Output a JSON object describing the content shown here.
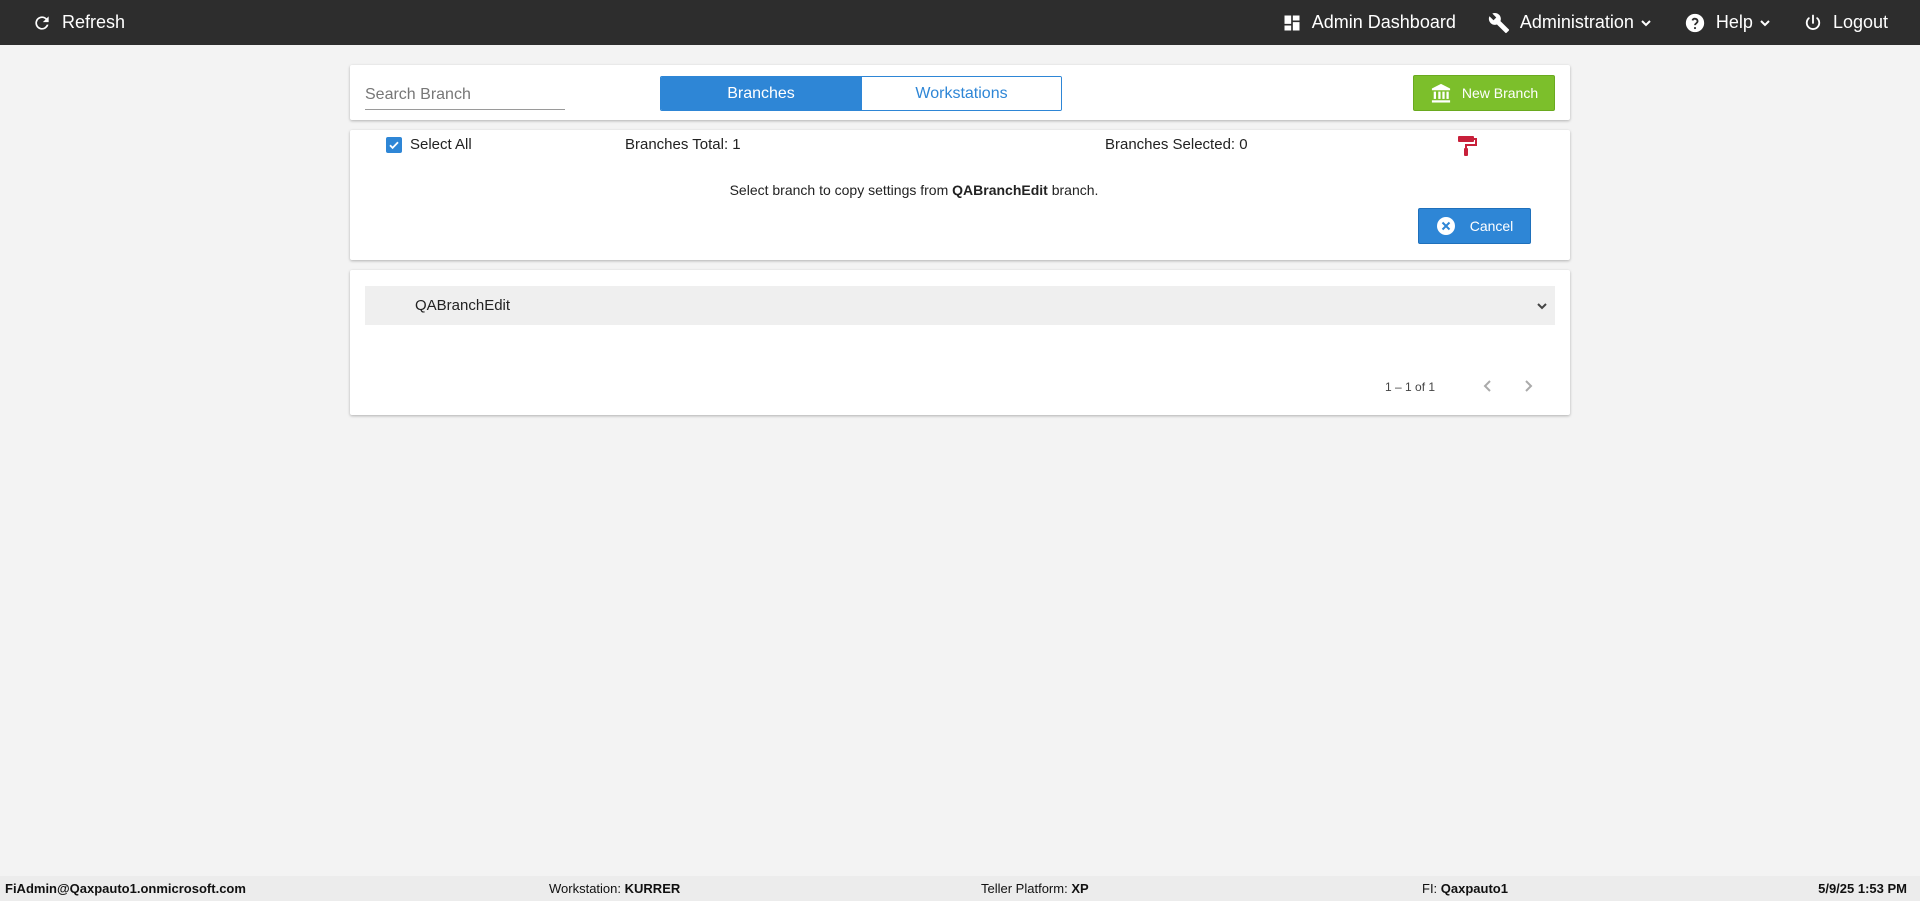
{
  "topbar": {
    "refresh_label": "Refresh",
    "admin_dashboard_label": "Admin Dashboard",
    "administration_label": "Administration",
    "help_label": "Help",
    "logout_label": "Logout"
  },
  "toolbar": {
    "search_placeholder": "Search Branch",
    "tabs": [
      {
        "label": "Branches",
        "active": true
      },
      {
        "label": "Workstations",
        "active": false
      }
    ],
    "new_branch_label": "New Branch"
  },
  "selection": {
    "select_all_label": "Select All",
    "select_all_checked": true,
    "branches_total_label": "Branches Total: 1",
    "branches_selected_label": "Branches Selected: 0",
    "hint_prefix": "Select branch to copy settings from",
    "hint_branch": "QABranchEdit",
    "hint_suffix": "branch.",
    "cancel_label": "Cancel"
  },
  "list": {
    "items": [
      {
        "label": "QABranchEdit"
      }
    ],
    "pager_text": "1 – 1 of 1"
  },
  "footer": {
    "user": "FiAdmin@Qaxpauto1.onmicrosoft.com",
    "workstation_label": "Workstation:",
    "workstation_value": "KURRER",
    "platform_label": "Teller Platform:",
    "platform_value": "XP",
    "fi_label": "FI:",
    "fi_value": "Qaxpauto1",
    "datetime": "5/9/25 1:53 PM"
  },
  "colors": {
    "topbar": "#2d2d2d",
    "accent_blue": "#2e86d6",
    "accent_green": "#7cbf2b",
    "paint_red": "#c8203a"
  }
}
